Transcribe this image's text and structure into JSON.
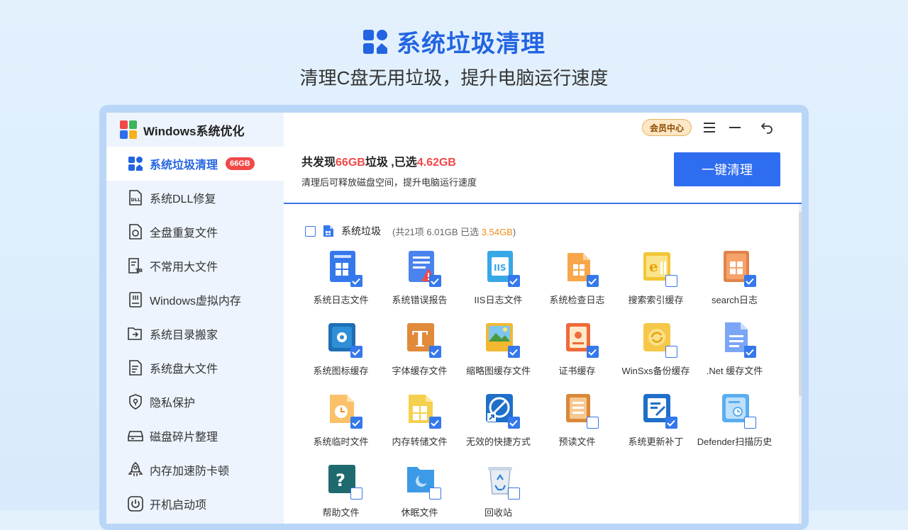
{
  "hero": {
    "title": "系统垃圾清理",
    "subtitle": "清理C盘无用垃圾，提升电脑运行速度"
  },
  "brand": {
    "name": "Windows系统优化"
  },
  "sidebar": {
    "items": [
      {
        "label": "系统垃圾清理",
        "badge": "66GB",
        "icon": "broom-grid-icon"
      },
      {
        "label": "系统DLL修复",
        "icon": "dll-file-icon"
      },
      {
        "label": "全盘重复文件",
        "icon": "duplicate-file-icon"
      },
      {
        "label": "不常用大文件",
        "icon": "large-file-icon"
      },
      {
        "label": "Windows虚拟内存",
        "icon": "memory-icon"
      },
      {
        "label": "系统目录搬家",
        "icon": "folder-move-icon"
      },
      {
        "label": "系统盘大文件",
        "icon": "disk-file-icon"
      },
      {
        "label": "隐私保护",
        "icon": "shield-icon"
      },
      {
        "label": "磁盘碎片整理",
        "icon": "disk-icon"
      },
      {
        "label": "内存加速防卡顿",
        "icon": "rocket-icon"
      },
      {
        "label": "开机启动项",
        "icon": "power-icon"
      }
    ]
  },
  "topbar": {
    "vip_label": "会员中心"
  },
  "summary": {
    "prefix": "共发现",
    "found": "66GB",
    "middle": "垃圾 ,已选",
    "selected": "4.62GB",
    "subtitle": "清理后可释放磁盘空间，提升电脑运行速度"
  },
  "actions": {
    "clean_label": "一键清理"
  },
  "category": {
    "name": "系统垃圾",
    "meta_prefix": "(共21项 6.01GB 已选 ",
    "meta_selected": "3.54GB",
    "meta_suffix": ")"
  },
  "items": [
    {
      "label": "系统日志文件",
      "checked": true,
      "icon": "log-file-icon"
    },
    {
      "label": "系统错误报告",
      "checked": true,
      "icon": "error-report-icon"
    },
    {
      "label": "IIS日志文件",
      "checked": true,
      "icon": "iis-log-icon"
    },
    {
      "label": "系统检查日志",
      "checked": true,
      "icon": "check-log-icon"
    },
    {
      "label": "搜索索引缓存",
      "checked": false,
      "icon": "search-index-icon"
    },
    {
      "label": "search日志",
      "checked": true,
      "icon": "search-log-icon"
    },
    {
      "label": "系统图标缓存",
      "checked": true,
      "icon": "icon-cache-icon"
    },
    {
      "label": "字体缓存文件",
      "checked": true,
      "icon": "font-cache-icon"
    },
    {
      "label": "缩略图缓存文件",
      "checked": true,
      "icon": "thumbnail-cache-icon"
    },
    {
      "label": "证书缓存",
      "checked": true,
      "icon": "certificate-icon"
    },
    {
      "label": "WinSxs备份缓存",
      "checked": false,
      "icon": "winsxs-icon"
    },
    {
      "label": ".Net 缓存文件",
      "checked": true,
      "icon": "dotnet-file-icon"
    },
    {
      "label": "系统临时文件",
      "checked": true,
      "icon": "temp-file-icon"
    },
    {
      "label": "内存转储文件",
      "checked": true,
      "icon": "dump-file-icon"
    },
    {
      "label": "无效的快捷方式",
      "checked": true,
      "icon": "shortcut-icon"
    },
    {
      "label": "预读文件",
      "checked": false,
      "icon": "prefetch-icon"
    },
    {
      "label": "系统更新补丁",
      "checked": true,
      "icon": "update-patch-icon"
    },
    {
      "label": "Defender扫描历史",
      "checked": false,
      "icon": "defender-icon"
    },
    {
      "label": "帮助文件",
      "checked": false,
      "icon": "help-file-icon"
    },
    {
      "label": "休眠文件",
      "checked": false,
      "icon": "hibernate-file-icon"
    },
    {
      "label": "回收站",
      "checked": false,
      "icon": "recycle-bin-icon"
    }
  ],
  "colors": {
    "accent": "#2f6df0",
    "badge": "#f14848",
    "highlight": "#f08c1a"
  }
}
